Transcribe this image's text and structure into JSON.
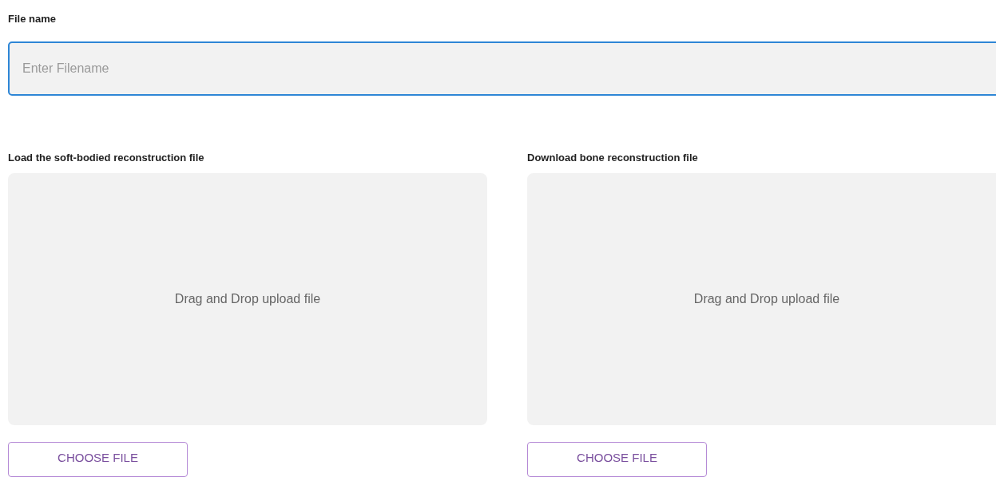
{
  "filename": {
    "label": "File name",
    "placeholder": "Enter Filename"
  },
  "uploads": [
    {
      "label": "Load the soft-bodied reconstruction file",
      "dropzone_text": "Drag and Drop upload file",
      "button": "CHOOSE FILE"
    },
    {
      "label": "Download bone reconstruction file",
      "dropzone_text": "Drag and Drop upload file",
      "button": "CHOOSE FILE"
    }
  ]
}
